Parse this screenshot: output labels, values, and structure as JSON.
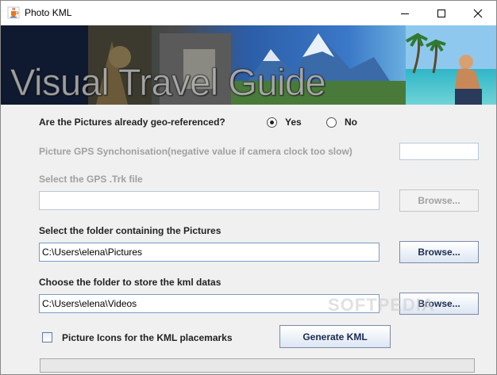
{
  "window": {
    "title": "Photo KML",
    "controls": [
      "minimize-icon",
      "maximize-icon",
      "close-icon"
    ]
  },
  "banner": {
    "title": "Visual Travel Guide"
  },
  "georef": {
    "question": "Are the Pictures already geo-referenced?",
    "options": [
      {
        "label": "Yes",
        "selected": true
      },
      {
        "label": "No",
        "selected": false
      }
    ]
  },
  "gps_sync": {
    "label": "Picture GPS Synchonisation(negative value if camera clock too slow)",
    "value": ""
  },
  "gps_file": {
    "label": "Select the GPS .Trk file",
    "value": "",
    "browse_label": "Browse..."
  },
  "pictures_folder": {
    "label": "Select the folder containing the Pictures",
    "value": "C:\\Users\\elena\\Pictures",
    "browse_label": "Browse..."
  },
  "kml_folder": {
    "label": "Choose the folder to store the kml datas",
    "value": "C:\\Users\\elena\\Videos",
    "browse_label": "Browse..."
  },
  "picture_icons": {
    "label": "Picture Icons for the KML placemarks",
    "checked": false
  },
  "generate": {
    "label": "Generate KML"
  },
  "progress": {
    "fraction": 0
  },
  "watermark": {
    "text": "SOFTPEDIA"
  }
}
